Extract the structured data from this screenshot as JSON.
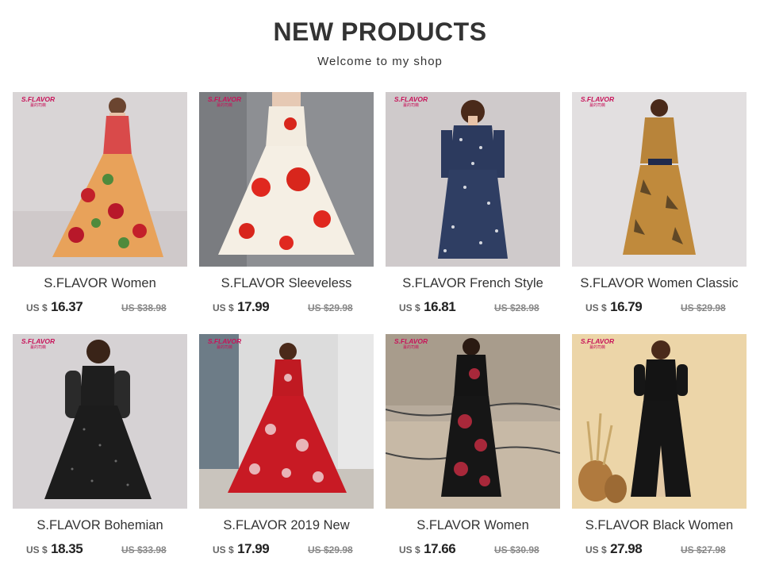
{
  "header": {
    "title": "NEW PRODUCTS",
    "subtitle": "Welcome to my shop"
  },
  "brand_mark": {
    "logo": "S.FLAVOR",
    "sub": "蔓的司薇"
  },
  "products": [
    {
      "name": "S.FLAVOR Women",
      "currency": "US $",
      "price": "16.37",
      "old_price": "US $38.98",
      "image": "woman in red floral sleeveless maxi dress"
    },
    {
      "name": "S.FLAVOR Sleeveless",
      "currency": "US $",
      "price": "17.99",
      "old_price": "US $29.98",
      "image": "white dress with red poppy print"
    },
    {
      "name": "S.FLAVOR French Style",
      "currency": "US $",
      "price": "16.81",
      "old_price": "US $28.98",
      "image": "navy printed midi dress"
    },
    {
      "name": "S.FLAVOR Women Classic",
      "currency": "US $",
      "price": "16.79",
      "old_price": "US $29.98",
      "image": "leaf print maxi dress with navy bow"
    },
    {
      "name": "S.FLAVOR Bohemian",
      "currency": "US $",
      "price": "18.35",
      "old_price": "US $33.98",
      "image": "black polka dot long sleeve maxi dress"
    },
    {
      "name": "S.FLAVOR 2019 New",
      "currency": "US $",
      "price": "17.99",
      "old_price": "US $29.98",
      "image": "red rose print halter maxi dress"
    },
    {
      "name": "S.FLAVOR Women",
      "currency": "US $",
      "price": "17.66",
      "old_price": "US $30.98",
      "image": "black floral maxi dress outdoors"
    },
    {
      "name": "S.FLAVOR Black Women",
      "currency": "US $",
      "price": "27.98",
      "old_price": "US $27.98",
      "image": "black v-neck split maxi dress"
    }
  ],
  "colors": {
    "title": "#333333",
    "price": "#222222",
    "old_price": "#888888",
    "brand": "#c8145a"
  }
}
